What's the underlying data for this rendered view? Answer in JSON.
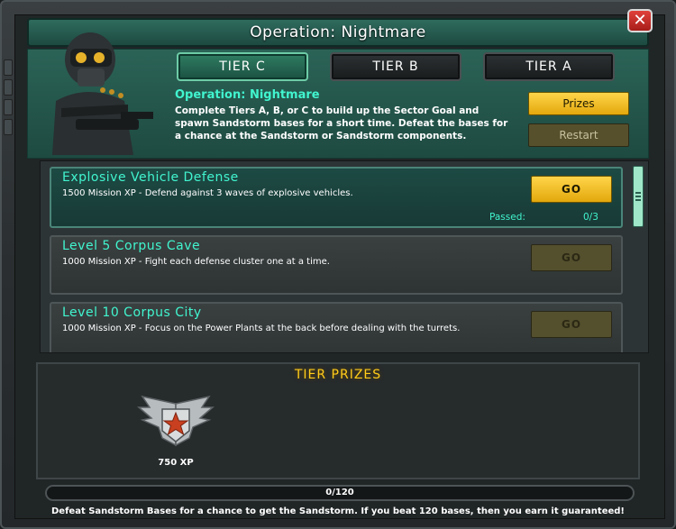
{
  "window": {
    "title": "Operation: Nightmare",
    "close_symbol": "✕"
  },
  "tabs": [
    {
      "label": "TIER C",
      "active": true
    },
    {
      "label": "TIER B",
      "active": false
    },
    {
      "label": "TIER A",
      "active": false
    }
  ],
  "operation": {
    "name": "Operation: Nightmare",
    "description": "Complete Tiers A, B, or C to build up the Sector Goal and spawn Sandstorm bases for a short time. Defeat the bases for a chance at the Sandstorm or Sandstorm components.",
    "prizes_label": "Prizes",
    "restart_label": "Restart"
  },
  "missions": [
    {
      "title": "Explosive Vehicle Defense",
      "description": "1500 Mission XP - Defend against 3 waves of explosive vehicles.",
      "go_label": "GO",
      "enabled": true,
      "passed_label": "Passed:",
      "progress": "0/3"
    },
    {
      "title": "Level 5 Corpus Cave",
      "description": "1000 Mission XP - Fight each defense cluster one at a time.",
      "go_label": "GO",
      "enabled": false
    },
    {
      "title": "Level 10 Corpus City",
      "description": "1000 Mission XP - Focus on the Power Plants at the back before dealing with the turrets.",
      "go_label": "GO",
      "enabled": false
    }
  ],
  "tier_prizes": {
    "title": "TIER PRIZES",
    "items": [
      {
        "icon": "xp-wings-star-badge-icon",
        "label": "750 XP"
      }
    ]
  },
  "progress": {
    "current": 0,
    "total": 120,
    "text": "0/120"
  },
  "footer": {
    "text": "Defeat Sandstorm Bases for a chance to get the Sandstorm. If you beat 120 bases, then you earn it guaranteed!"
  },
  "colors": {
    "accent_cyan": "#41f5cf",
    "gold": "#ffcc1a",
    "panel_teal": "#2b6357"
  }
}
